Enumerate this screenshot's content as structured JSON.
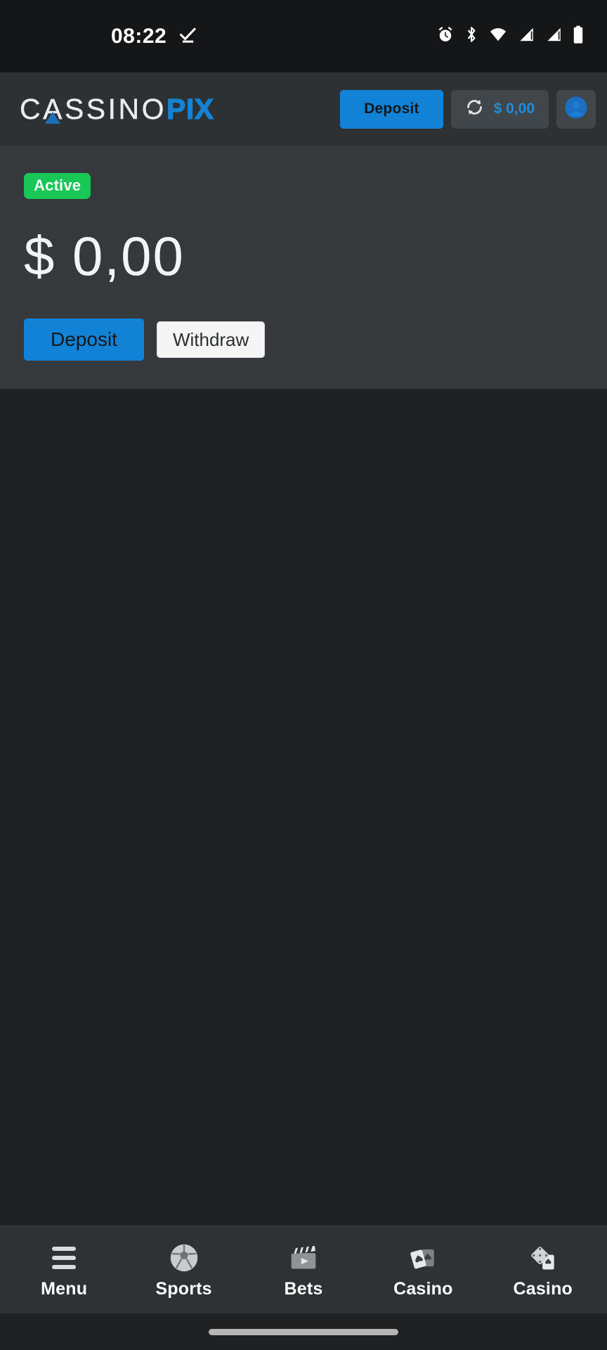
{
  "status_bar": {
    "time": "08:22",
    "icons": [
      "task-done-icon",
      "alarm-icon",
      "bluetooth-icon",
      "wifi-icon",
      "signal-sim1-icon",
      "signal-sim2-icon",
      "battery-icon"
    ]
  },
  "header": {
    "logo": {
      "part1": "CASSINO",
      "part2": "PIX",
      "accent_color": "#1682d4"
    },
    "deposit_label": "Deposit",
    "refresh_icon": "refresh-icon",
    "balance": "$ 0,00",
    "avatar_icon": "user-avatar-icon"
  },
  "account_panel": {
    "status_badge": "Active",
    "status_badge_color": "#18c755",
    "balance": "$ 0,00",
    "deposit_label": "Deposit",
    "withdraw_label": "Withdraw"
  },
  "bottom_nav": {
    "items": [
      {
        "label": "Menu",
        "icon": "hamburger-menu-icon"
      },
      {
        "label": "Sports",
        "icon": "soccer-ball-icon"
      },
      {
        "label": "Bets",
        "icon": "clapperboard-icon"
      },
      {
        "label": "Casino",
        "icon": "playing-cards-icon"
      },
      {
        "label": "Casino",
        "icon": "dice-card-icon"
      }
    ]
  },
  "colors": {
    "brand_blue": "#1282d6",
    "panel_bg": "#35393b",
    "header_bg": "#2d3133",
    "body_bg": "#1f2123",
    "nav_bg": "#2e3234"
  }
}
